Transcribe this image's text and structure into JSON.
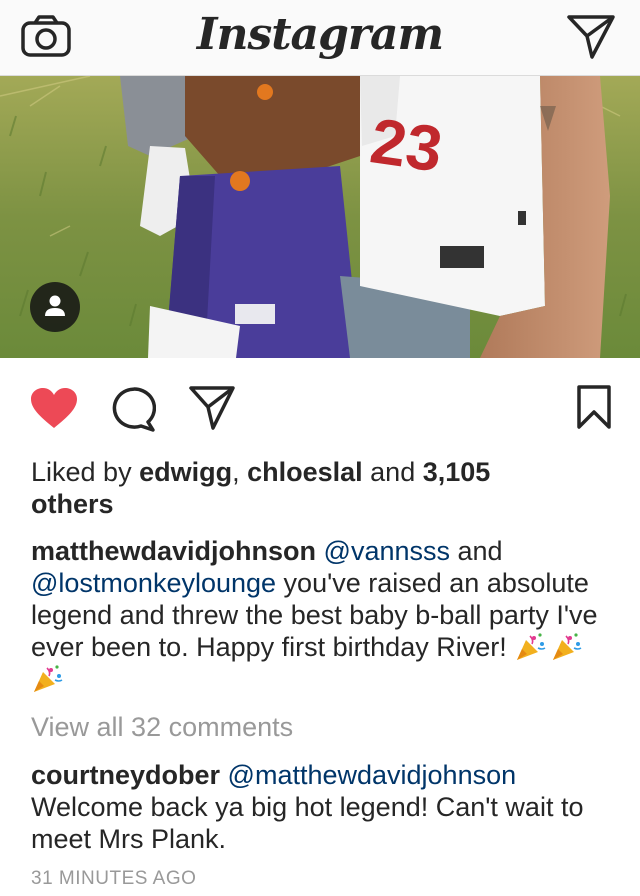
{
  "header": {
    "app_name": "Instagram",
    "camera_icon": "camera-icon",
    "direct_icon": "paper-plane-icon"
  },
  "photo": {
    "jersey_number": "23",
    "user_tag_icon": "person-icon"
  },
  "actions": {
    "like_icon": "heart-icon",
    "like_color": "#ed4956",
    "comment_icon": "comment-bubble-icon",
    "share_icon": "paper-plane-icon",
    "save_icon": "bookmark-icon"
  },
  "likes": {
    "prefix": "Liked by ",
    "user1": "edwigg",
    "separator": ", ",
    "user2": "chloeslal",
    "middle": " and ",
    "count": "3,105",
    "suffix": "others"
  },
  "caption": {
    "author": "matthewdavidjohnson",
    "mention1": "@vannsss",
    "and": " and ",
    "mention2": "@lostmonkeylounge",
    "text": " you've raised an absolute legend and threw the best baby b-ball party I've ever been to. Happy first birthday River! ",
    "emoji": "party-popper-icon",
    "emoji_count": 3
  },
  "view_all": "View all 32 comments",
  "comment": {
    "author": "courtneydober",
    "mention": "@matthewdavidjohnson",
    "text": "Welcome back ya big hot legend! Can't wait to meet Mrs Plank."
  },
  "timestamp": "31 MINUTES AGO",
  "colors": {
    "mention": "#003569",
    "muted": "#999999",
    "text": "#262626",
    "header_bg": "#fafafa"
  }
}
